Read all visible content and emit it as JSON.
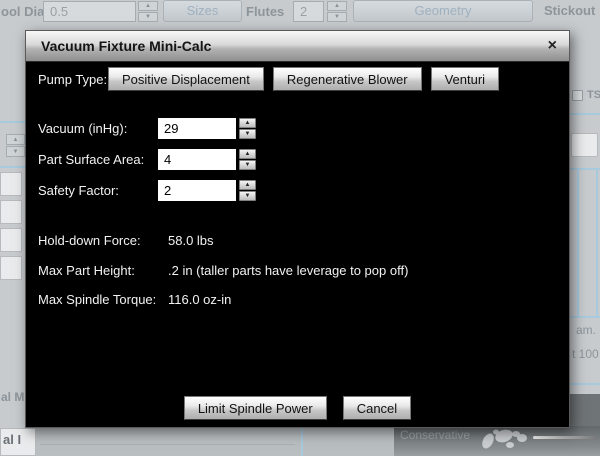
{
  "background": {
    "top_bar": {
      "tool_dia_label": "ool Dia.",
      "tool_dia_value": "0.5",
      "sizes_button": "Sizes",
      "flutes_label": "Flutes",
      "flutes_value": "2",
      "geometry_button": "Geometry",
      "stickout_label": "Stickout"
    },
    "right_rail": {
      "ts_label": "TS",
      "fragment_am": "am.",
      "fragment_t100": "t 100"
    },
    "bottom": {
      "fragment_material": "al M",
      "fragment_al": "al I",
      "conservative_label": "Conservative"
    }
  },
  "icons": {
    "close": "×",
    "spinner_up": "▲",
    "spinner_down": "▼"
  },
  "dialog": {
    "title": "Vacuum Fixture Mini-Calc",
    "pump_type": {
      "label": "Pump Type:",
      "options": [
        "Positive Displacement",
        "Regenerative Blower",
        "Venturi"
      ]
    },
    "inputs": [
      {
        "label": "Vacuum (inHg):",
        "value": "29"
      },
      {
        "label": "Part Surface Area:",
        "value": "4"
      },
      {
        "label": "Safety Factor:",
        "value": "2"
      }
    ],
    "results": [
      {
        "label": "Hold-down Force:",
        "value": "58.0 lbs"
      },
      {
        "label": "Max Part Height:",
        "value": ".2 in (taller parts have leverage to pop off)"
      },
      {
        "label": "Max Spindle Torque:",
        "value": "116.0 oz-in"
      }
    ],
    "actions": {
      "limit_spindle_power": "Limit Spindle Power",
      "cancel": "Cancel"
    }
  },
  "colors": {
    "dialog_body": "#000000",
    "dialog_text": "#f2f2f2",
    "accent_blue_line": "#a8cade",
    "bottom_band_gray": "#64696b"
  }
}
